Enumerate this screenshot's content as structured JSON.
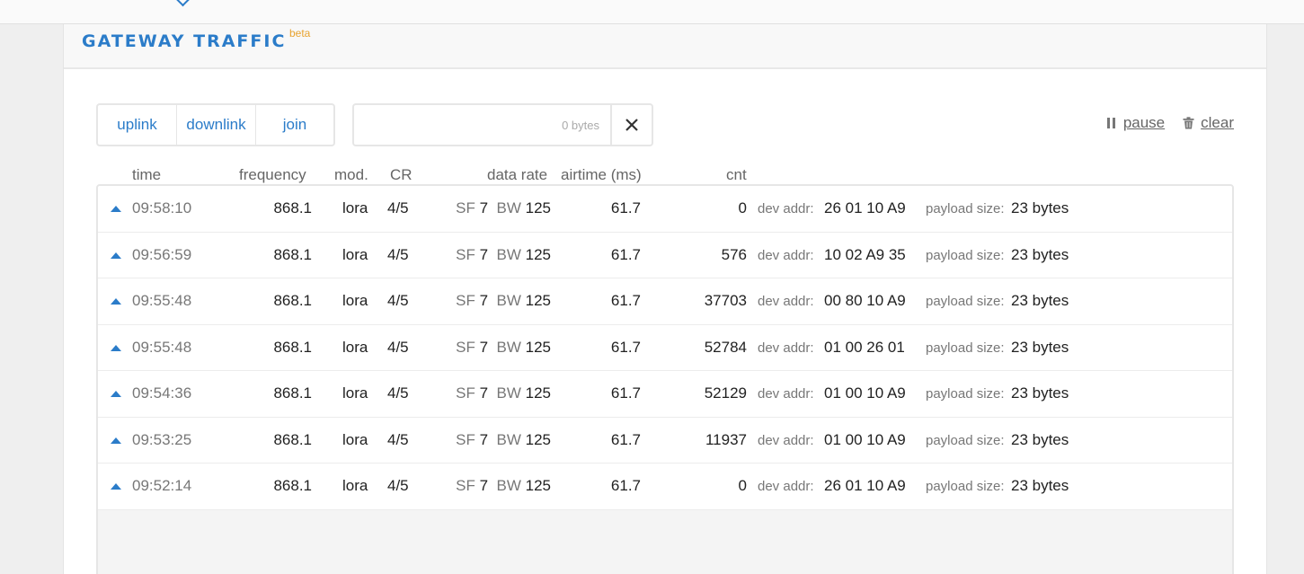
{
  "panel": {
    "title": "GATEWAY TRAFFIC",
    "badge": "beta"
  },
  "filters": [
    {
      "label": "uplink"
    },
    {
      "label": "downlink"
    },
    {
      "label": "join"
    }
  ],
  "search": {
    "value": "",
    "count": "0 bytes"
  },
  "controls": {
    "pause_label": "pause",
    "clear_label": "clear"
  },
  "columns": {
    "time": "time",
    "frequency": "frequency",
    "mod": "mod.",
    "cr": "CR",
    "data_rate": "data rate",
    "airtime": "airtime (ms)",
    "cnt": "cnt"
  },
  "labels": {
    "sf": "SF",
    "bw": "BW",
    "dev_addr": "dev addr:",
    "payload_size": "payload size:"
  },
  "rows": [
    {
      "time": "09:58:10",
      "frequency": "868.1",
      "mod": "lora",
      "cr": "4/5",
      "sf": "7",
      "bw": "125",
      "airtime": "61.7",
      "cnt": "0",
      "dev_addr": "26 01 10 A9",
      "payload": "23 bytes"
    },
    {
      "time": "09:56:59",
      "frequency": "868.1",
      "mod": "lora",
      "cr": "4/5",
      "sf": "7",
      "bw": "125",
      "airtime": "61.7",
      "cnt": "576",
      "dev_addr": "10 02 A9 35",
      "payload": "23 bytes"
    },
    {
      "time": "09:55:48",
      "frequency": "868.1",
      "mod": "lora",
      "cr": "4/5",
      "sf": "7",
      "bw": "125",
      "airtime": "61.7",
      "cnt": "37703",
      "dev_addr": "00 80 10 A9",
      "payload": "23 bytes"
    },
    {
      "time": "09:55:48",
      "frequency": "868.1",
      "mod": "lora",
      "cr": "4/5",
      "sf": "7",
      "bw": "125",
      "airtime": "61.7",
      "cnt": "52784",
      "dev_addr": "01 00 26 01",
      "payload": "23 bytes"
    },
    {
      "time": "09:54:36",
      "frequency": "868.1",
      "mod": "lora",
      "cr": "4/5",
      "sf": "7",
      "bw": "125",
      "airtime": "61.7",
      "cnt": "52129",
      "dev_addr": "01 00 10 A9",
      "payload": "23 bytes"
    },
    {
      "time": "09:53:25",
      "frequency": "868.1",
      "mod": "lora",
      "cr": "4/5",
      "sf": "7",
      "bw": "125",
      "airtime": "61.7",
      "cnt": "11937",
      "dev_addr": "01 00 10 A9",
      "payload": "23 bytes"
    },
    {
      "time": "09:52:14",
      "frequency": "868.1",
      "mod": "lora",
      "cr": "4/5",
      "sf": "7",
      "bw": "125",
      "airtime": "61.7",
      "cnt": "0",
      "dev_addr": "26 01 10 A9",
      "payload": "23 bytes"
    }
  ]
}
